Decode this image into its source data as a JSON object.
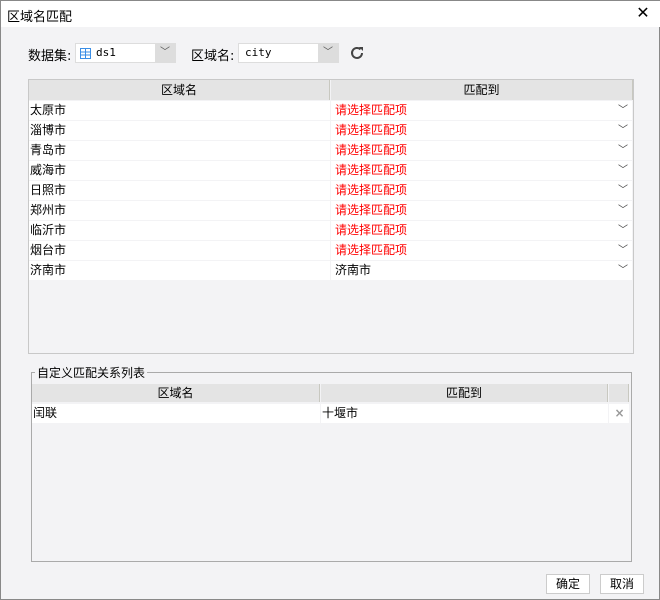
{
  "window": {
    "title": "区域名匹配",
    "close": "✕"
  },
  "toolbar": {
    "dataset_label": "数据集:",
    "dataset_value": "ds1",
    "region_label": "区域名:",
    "region_value": "city",
    "dataset_icon": "table-icon",
    "refresh_icon": "refresh-icon"
  },
  "table": {
    "headers": [
      "区域名",
      "匹配到"
    ],
    "rows": [
      {
        "name": "太原市",
        "match": "请选择匹配项",
        "unset": true
      },
      {
        "name": "淄博市",
        "match": "请选择匹配项",
        "unset": true
      },
      {
        "name": "青岛市",
        "match": "请选择匹配项",
        "unset": true
      },
      {
        "name": "威海市",
        "match": "请选择匹配项",
        "unset": true
      },
      {
        "name": "日照市",
        "match": "请选择匹配项",
        "unset": true
      },
      {
        "name": "郑州市",
        "match": "请选择匹配项",
        "unset": true
      },
      {
        "name": "临沂市",
        "match": "请选择匹配项",
        "unset": true
      },
      {
        "name": "烟台市",
        "match": "请选择匹配项",
        "unset": true
      },
      {
        "name": "济南市",
        "match": "济南市",
        "unset": false
      }
    ]
  },
  "custom": {
    "title": "自定义匹配关系列表",
    "headers": [
      "区域名",
      "匹配到"
    ],
    "rows": [
      {
        "name": "闰联",
        "match": "十堰市"
      }
    ]
  },
  "buttons": {
    "ok": "确定",
    "cancel": "取消"
  }
}
